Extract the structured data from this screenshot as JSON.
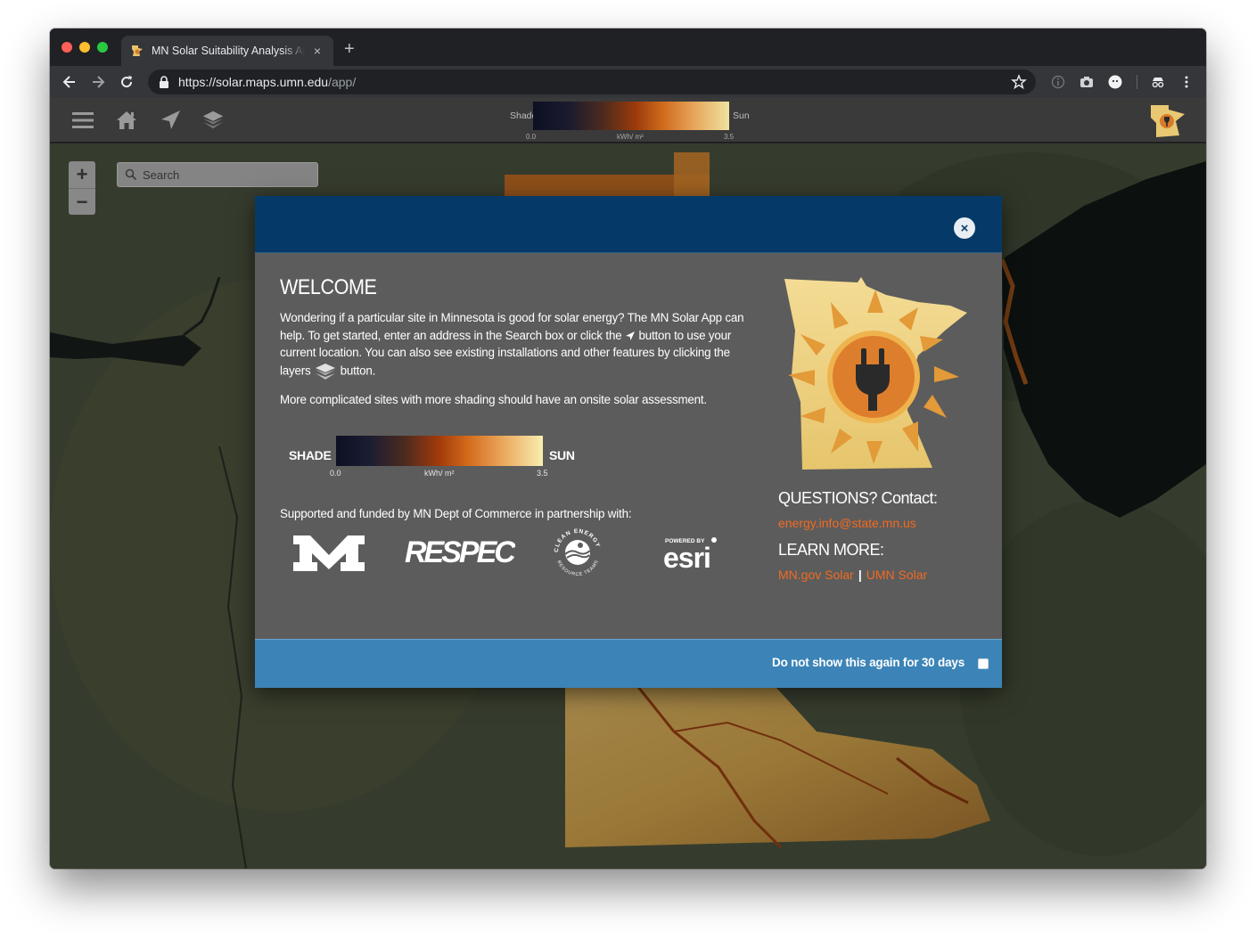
{
  "browser": {
    "tab_title": "MN Solar Suitability Analysis App",
    "tab_close": "×",
    "new_tab": "+",
    "url_host": "https://solar.maps.umn.edu",
    "url_path": "/app/"
  },
  "header_legend": {
    "shade_label": "Shade",
    "sun_label": "Sun",
    "min": "0.0",
    "max": "3.5",
    "unit": "kWh/ m²"
  },
  "map": {
    "zoom_in": "+",
    "zoom_out": "−",
    "search_placeholder": "Search"
  },
  "modal": {
    "close": "×",
    "title": "WELCOME",
    "intro_part1": "Wondering if a particular site in Minnesota is good for solar energy? The MN Solar App can help. To get started, enter an address in the Search box or click the",
    "intro_part2": "button to use your current location. You can also see existing installations and other features by clicking the layers",
    "intro_part3": "button.",
    "note": "More complicated sites with more shading should have an onsite solar assessment.",
    "legend": {
      "shade": "SHADE",
      "sun": "SUN",
      "min": "0.0",
      "max": "3.5",
      "unit": "kWh/ m²"
    },
    "supported": "Supported and funded by MN Dept of Commerce in partnership with:",
    "partners": {
      "respec": "RESPEC",
      "esri_small": "POWERED BY",
      "esri": "esri",
      "cert_top": "CLEAN ENERGY",
      "cert_bottom": "RESOURCE TEAMS"
    },
    "questions": "QUESTIONS? Contact:",
    "email": "energy.info@state.mn.us",
    "learn_more": "LEARN MORE:",
    "link1": "MN.gov Solar",
    "link_sep": "|",
    "link2": "UMN Solar",
    "footer_label": "Do not show this again for 30 days"
  },
  "colors": {
    "modal_header": "#053a68",
    "modal_body": "#5c5c5c",
    "modal_footer": "#3c84b7",
    "link": "#f26b21"
  }
}
